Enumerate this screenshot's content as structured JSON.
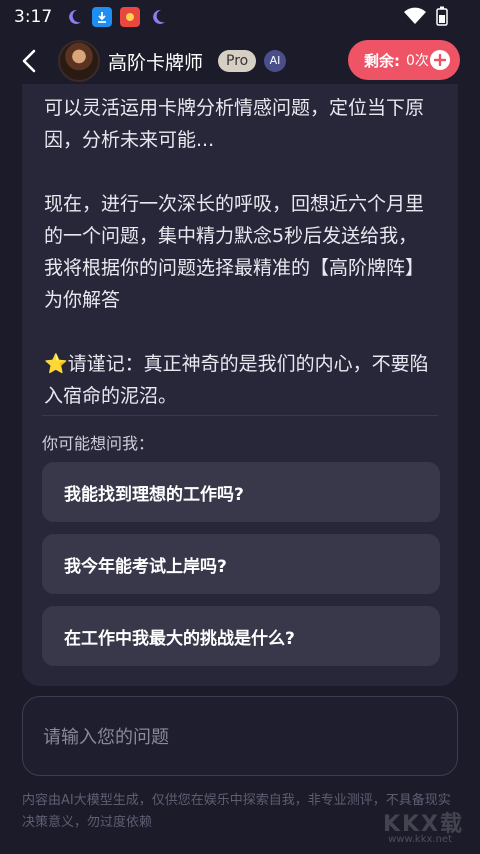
{
  "status_bar": {
    "time": "3:17"
  },
  "header": {
    "title": "高阶卡牌师",
    "pro_badge": "Pro",
    "ai_badge": "AI",
    "remain_label": "剩余:",
    "remain_count": "0次"
  },
  "message": {
    "text": "可以灵活运用卡牌分析情感问题，定位当下原因，分析未来可能...\n\n现在，进行一次深长的呼吸，回想近六个月里的一个问题，集中精力默念5秒后发送给我，我将根据你的问题选择最精准的【高阶牌阵】为你解答\n\n⭐请谨记：真正神奇的是我们的内心，不要陷入宿命的泥沼。"
  },
  "suggestions": {
    "title": "你可能想问我：",
    "items": [
      "我能找到理想的工作吗?",
      "我今年能考试上岸吗?",
      "在工作中我最大的挑战是什么?"
    ]
  },
  "input": {
    "placeholder": "请输入您的问题"
  },
  "disclaimer": "内容由AI大模型生成，仅供您在娱乐中探索自我，非专业测评，不具备现实决策意义，勿过度依赖",
  "watermark": {
    "logo": "KKX载",
    "url": "www.kkx.net"
  },
  "colors": {
    "background": "#1c1b2a",
    "card": "#28273a",
    "accent": "#ee5466"
  }
}
